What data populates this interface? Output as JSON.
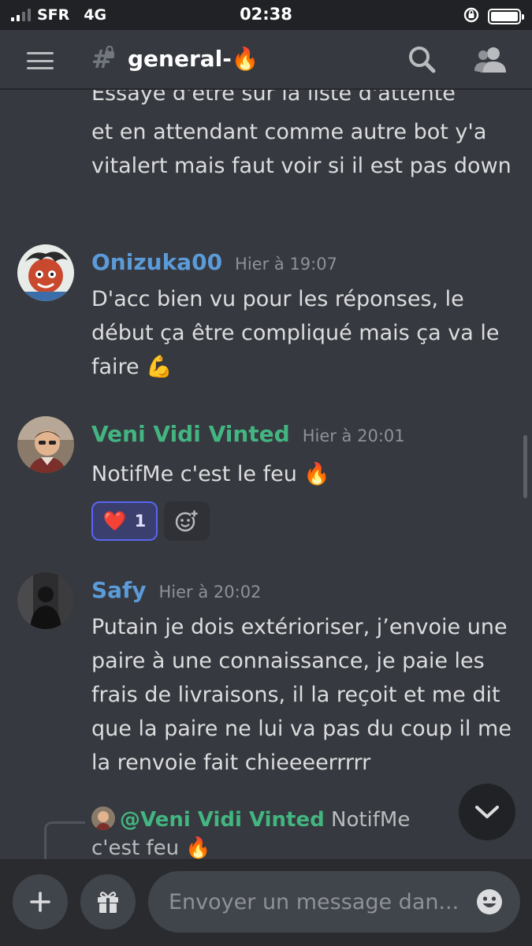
{
  "status_bar": {
    "carrier": "SFR",
    "network": "4G",
    "time": "02:38"
  },
  "header": {
    "channel_name": "general-🔥"
  },
  "messages": {
    "partial_cut": "Essaye d'être sur la liste d'attente",
    "continuation": "et en attendant comme autre bot y'a vitalert mais faut voir si il est pas down",
    "onizuka": {
      "author": "Onizuka00",
      "timestamp": "Hier à 19:07",
      "author_color": "#5b9bd9",
      "text": "D'acc bien vu pour les réponses, le début ça être compliqué mais ça va le faire 💪"
    },
    "veni": {
      "author": "Veni Vidi Vinted",
      "timestamp": "Hier à 20:01",
      "author_color": "#43b581",
      "text": "NotifMe c'est le feu 🔥",
      "reaction_emoji": "❤️",
      "reaction_count": "1"
    },
    "safy": {
      "author": "Safy",
      "timestamp": "Hier à 20:02",
      "author_color": "#5b9bd9",
      "text": "Putain je dois extérioriser, j’envoie une paire à une connaissance, je paie les frais de livraisons, il la reçoit et me dit que la paire ne lui va pas du coup il me la renvoie fait chieeeerrrrr"
    },
    "reply": {
      "mention": "@Veni Vidi Vinted",
      "text": " NotifMe c'est feu 🔥"
    }
  },
  "composer": {
    "placeholder": "Envoyer un message dan..."
  },
  "colors": {
    "background": "#36393f",
    "blurple": "#5865f2"
  },
  "icons": [
    "hamburger-icon",
    "search-icon",
    "members-icon",
    "add-reaction-icon",
    "chevron-down-icon",
    "plus-icon",
    "gift-icon",
    "emoji-icon"
  ]
}
